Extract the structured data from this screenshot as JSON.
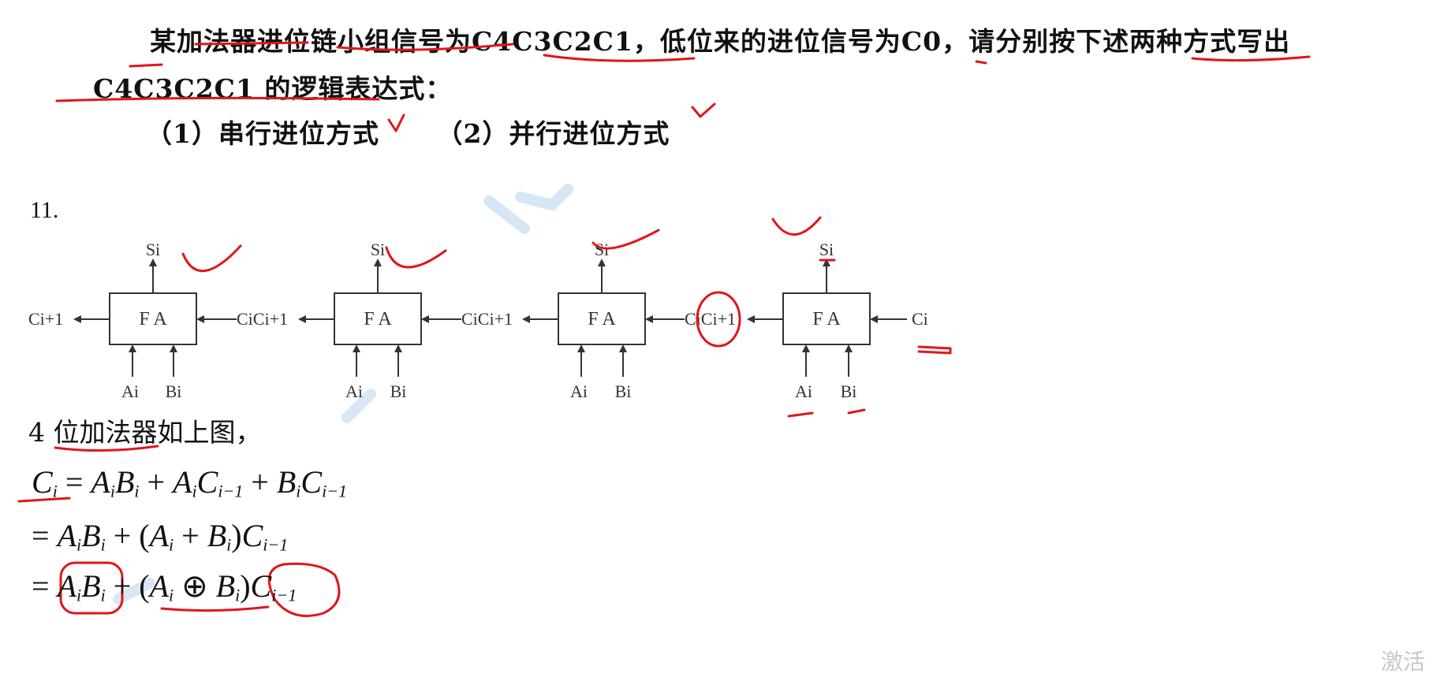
{
  "question": {
    "number": "11.",
    "line1": "某加法器进位链小组信号为C4C3C2C1，低位来的进位信号为C0，请分别按下述两种方式写出",
    "line2": "C4C3C2C1 的逻辑表达式：",
    "option1": "（1）串行进位方式",
    "option2": "（2）并行进位方式"
  },
  "answer": {
    "number": "11.",
    "diagram": {
      "block_label": "F A",
      "sum_output": "Si",
      "carry_out": "Ci+1",
      "carry_in": "Ci",
      "carry_between": "CiCi+1",
      "input_a": "Ai",
      "input_b": "Bi"
    },
    "caption": "4 位加法器如上图，",
    "formula": {
      "line1": "Ci = AiBi + AiCi−1 + BiCi−1",
      "line2": "= AiBi + (Ai + Bi)Ci−1",
      "line3": "= AiBi + (Ai ⊕ Bi)Ci−1"
    }
  },
  "watermark": "激活",
  "annotation_color": "#e0161b"
}
